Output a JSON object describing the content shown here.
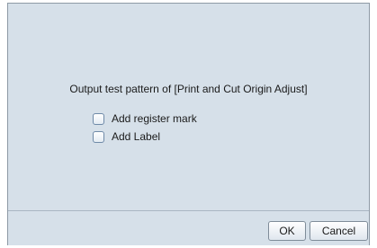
{
  "dialog": {
    "message": "Output test pattern of [Print and Cut Origin Adjust]",
    "options": [
      {
        "label": "Add register mark",
        "checked": false
      },
      {
        "label": "Add Label",
        "checked": false
      }
    ],
    "buttons": {
      "ok_label": "OK",
      "cancel_label": "Cancel"
    }
  },
  "colors": {
    "dialog_bg": "#d6e0e9",
    "border": "#8e9aa6",
    "checkbox_border": "#6f8aa8"
  }
}
